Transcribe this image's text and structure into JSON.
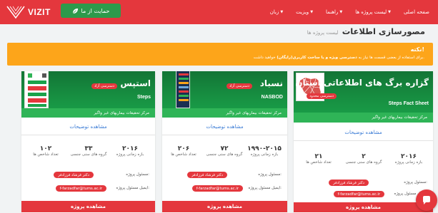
{
  "header": {
    "logo_text": "VIZIT",
    "support_label": "حمایت از ما",
    "nav": [
      {
        "label": "صفحه اصلی",
        "has_caret": false
      },
      {
        "label": "لیست پروژه ها",
        "has_caret": true
      },
      {
        "label": "راهنما",
        "has_caret": true
      },
      {
        "label": "ویزیت",
        "has_caret": true
      },
      {
        "label": "زبان",
        "has_caret": true
      }
    ]
  },
  "page": {
    "title": "مصورسازی اطلاعات",
    "subtitle": "لیست پروژه ها"
  },
  "notice": {
    "title": "نکته!",
    "body_pre": "برای استفاده از بعضی قسمت ها نیاز به",
    "body_bold": "دسترسی ویژه و یا ساخت کاربری(رایگان)",
    "body_post": "خواهید داشت."
  },
  "cards": [
    {
      "title": "گزاره برگ های اطلاعاتی استان",
      "en_title": "Steps Fact Sheet",
      "access_badge": "دسترسی محدود",
      "center": "مرکز تحقیقات بیماریهای غیر واگیر",
      "details_link": "مشاهده توضیحات",
      "stats": [
        {
          "value": "۲۰۱۶",
          "label": "بازه زمانی پروژه"
        },
        {
          "value": "۲",
          "label": "گروه های سنی جنسی"
        },
        {
          "value": "۲۱",
          "label": "تعداد شاخص ها"
        }
      ],
      "manager_label": "مسئول پروژه:",
      "manager": "دکتر فرشاد فرزادفر",
      "email_label": "ایمیل مسئول پروژه:",
      "email": "f-farzadfar@tums.ac.ir",
      "view_label": "مشاهده پروژه"
    },
    {
      "title": "نسباد",
      "en_title": "NASBOD",
      "access_badge": "دسترسی آزاد",
      "center": "مرکز تحقیقات بیماریهای غیر واگیر",
      "details_link": "مشاهده توضیحات",
      "stats": [
        {
          "value": "۱۹۹۰-۲۰۱۵",
          "label": "بازه زمانی پروژه"
        },
        {
          "value": "۷۲",
          "label": "گروه های سنی جنسی"
        },
        {
          "value": "۲۰۶",
          "label": "تعداد شاخص ها"
        }
      ],
      "manager_label": "مسئول پروژه:",
      "manager": "دکتر فرشاد فرزادفر",
      "email_label": "ایمیل مسئول پروژه:",
      "email": "f-farzadfar@tums.ac.ir",
      "view_label": "مشاهده پروژه"
    },
    {
      "title": "استپس",
      "en_title": "Steps",
      "access_badge": "دسترسی آزاد",
      "center": "مرکز تحقیقات بیماریهای غیر واگیر",
      "details_link": "مشاهده توضیحات",
      "stats": [
        {
          "value": "۲۰۱۶",
          "label": "بازه زمانی پروژه"
        },
        {
          "value": "۳۳",
          "label": "گروه های سنی جنسی"
        },
        {
          "value": "۱۰۲",
          "label": "تعداد شاخص ها"
        }
      ],
      "manager_label": "مسئول پروژه:",
      "manager": "دکتر فرشاد فرزادفر",
      "email_label": "ایمیل مسئول پروژه:",
      "email": "f-farzadfar@tums.ac.ir",
      "view_label": "مشاهده پروژه"
    }
  ],
  "icons": {
    "support": "leaf-icon",
    "chat": "chat-bubble-icon",
    "logo": "vizit-logo-icon"
  },
  "colors": {
    "brand_red": "#e4373d",
    "notice_orange": "#fda51a",
    "card_green": "#1aa24a",
    "support_green": "#2d9a4b",
    "link_blue": "#3a7bd5"
  }
}
